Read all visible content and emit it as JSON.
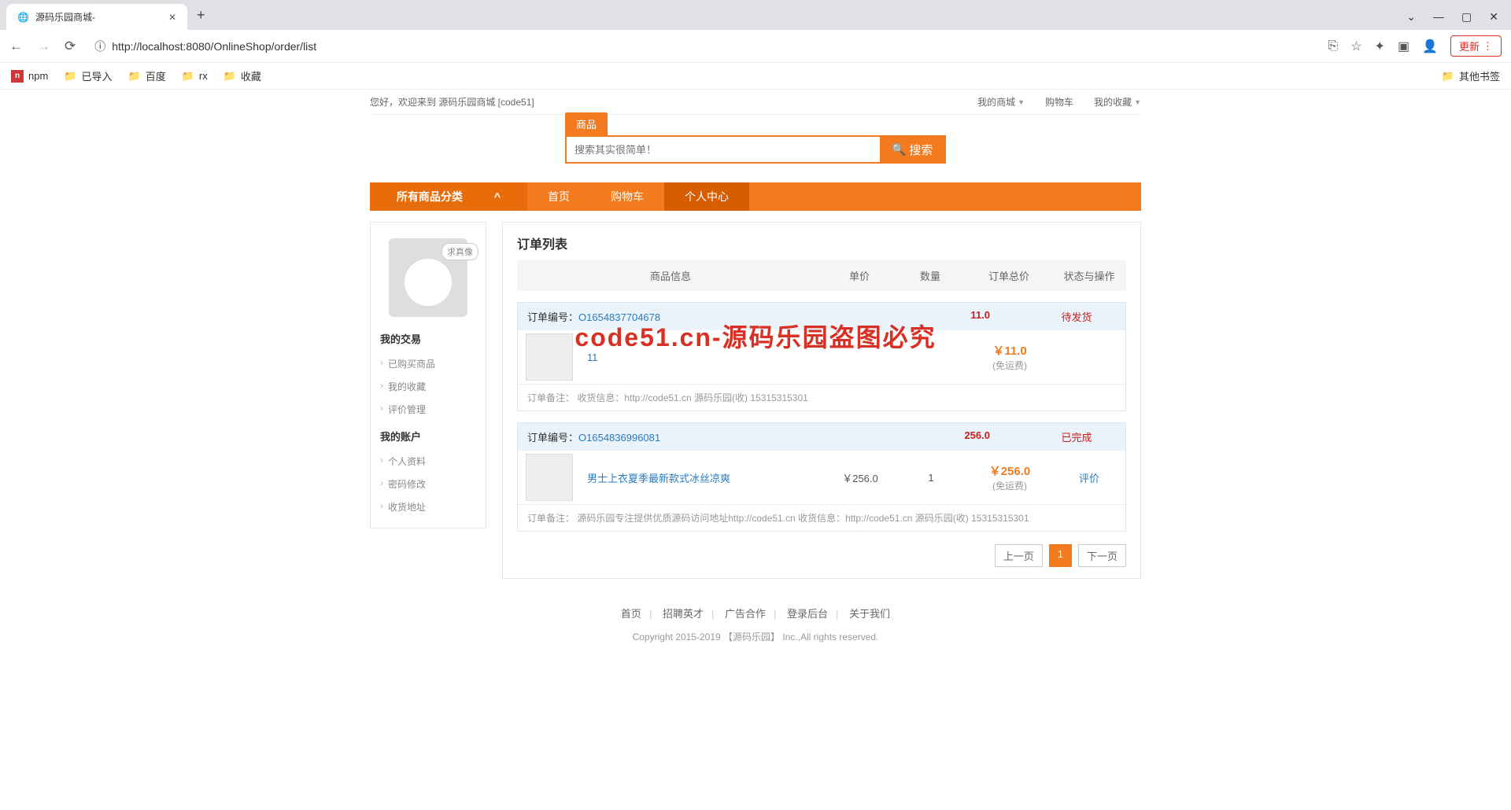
{
  "browser": {
    "tab_title": "源码乐园商城-",
    "url_display": "http://localhost:8080/OnlineShop/order/list",
    "update": "更新",
    "bookmarks": [
      "npm",
      "已导入",
      "百度",
      "rx",
      "收藏"
    ],
    "other_bm": "其他书签"
  },
  "topbar": {
    "welcome": "您好，欢迎来到 源码乐园商城  [code51]",
    "my_shop": "我的商城",
    "cart": "购物车",
    "favorites": "我的收藏"
  },
  "search": {
    "tab": "商品",
    "placeholder": "搜索其实很简单！",
    "button": "搜索"
  },
  "nav": {
    "all_cat": "所有商品分类",
    "items": [
      "首页",
      "购物车",
      "个人中心"
    ]
  },
  "sidebar": {
    "avatar_label": "求真像",
    "group1": {
      "title": "我的交易",
      "links": [
        "已购买商品",
        "我的收藏",
        "评价管理"
      ]
    },
    "group2": {
      "title": "我的账户",
      "links": [
        "个人资料",
        "密码修改",
        "收货地址"
      ]
    }
  },
  "panel": {
    "title": "订单列表",
    "headers": [
      "商品信息",
      "单价",
      "数量",
      "订单总价",
      "状态与操作"
    ],
    "note_label": "订单备注：",
    "num_label": "订单编号：",
    "shipping": "(免运费)"
  },
  "orders": [
    {
      "num": "O1654837704678",
      "total": "11.0",
      "status": "待发货",
      "name": "11",
      "price": "",
      "qty": "",
      "amt": "￥11.0",
      "action": "",
      "note": "收货信息：http://code51.cn 源码乐园(收) 15315315301"
    },
    {
      "num": "O1654836996081",
      "total": "256.0",
      "status": "已完成",
      "name": "男士上衣夏季最新款式冰丝凉爽",
      "price": "￥256.0",
      "qty": "1",
      "amt": "￥256.0",
      "action": "评价",
      "note": "源码乐园专注提供优质源码访问地址http://code51.cn  收货信息：http://code51.cn 源码乐园(收) 15315315301"
    }
  ],
  "pager": {
    "prev": "上一页",
    "cur": "1",
    "next": "下一页"
  },
  "footer": {
    "links": [
      "首页",
      "招聘英才",
      "广告合作",
      "登录后台",
      "关于我们"
    ],
    "copy": "Copyright 2015-2019 【源码乐园】 Inc.,All rights reserved."
  },
  "watermark": "code51.cn-源码乐园盗图必究"
}
